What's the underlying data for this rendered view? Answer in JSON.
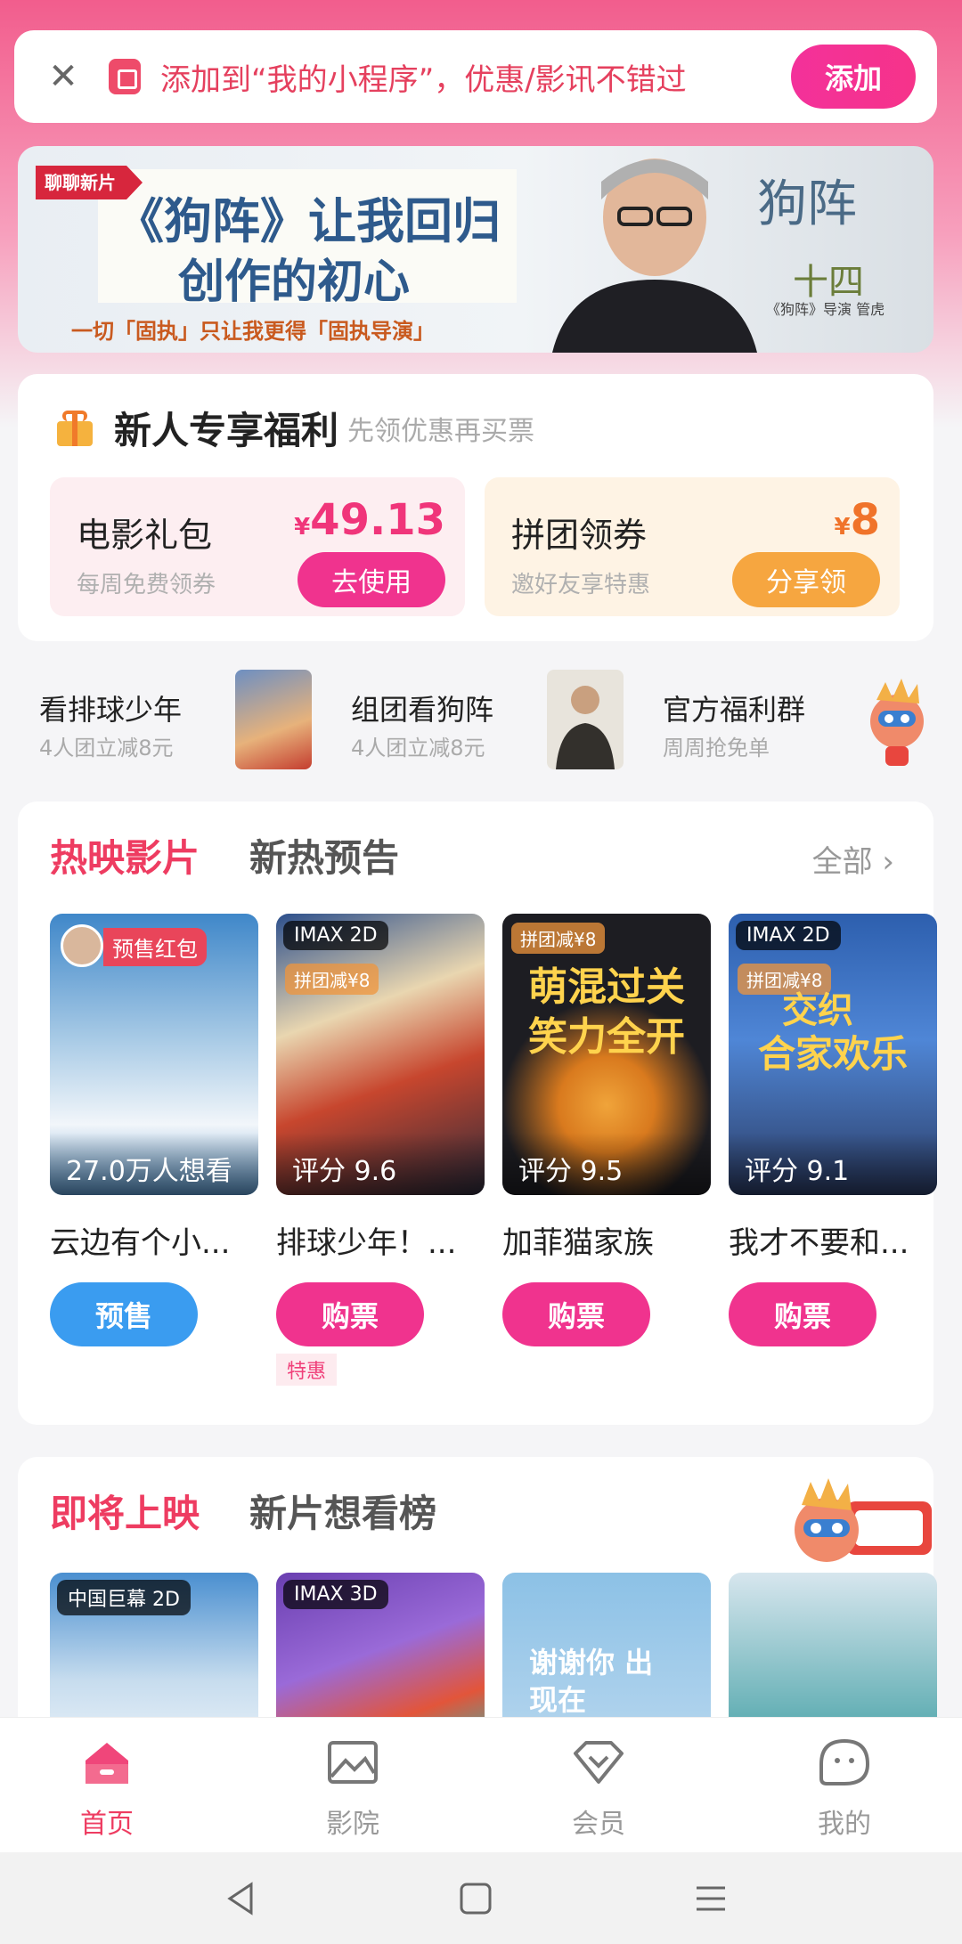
{
  "add_bar": {
    "text": "添加到“我的小程序”，优惠/影讯不错过",
    "button": "添加",
    "close_glyph": "✕"
  },
  "banner": {
    "tag": "聊聊新片",
    "line1": "《狗阵》让我回归",
    "line2": "创作的初心",
    "subline": "一切「固执」只让我更得「固执导演」",
    "calligraphy": "狗阵",
    "calligraphy_sub": "十四",
    "calligraphy_small": "《狗阵》导演 管虎"
  },
  "welfare": {
    "title": "新人专享福利",
    "subtitle": "先领优惠再买票",
    "coupons": [
      {
        "title": "电影礼包",
        "sub": "每周免费领券",
        "currency": "¥",
        "price": "49.13",
        "button": "去使用"
      },
      {
        "title": "拼团领券",
        "sub": "邀好友享特惠",
        "currency": "¥",
        "price": "8",
        "button": "分享领"
      }
    ]
  },
  "promos": [
    {
      "title": "看排球少年",
      "sub": "4人团立减8元"
    },
    {
      "title": "组团看狗阵",
      "sub": "4人团立减8元"
    },
    {
      "title": "官方福利群",
      "sub": "周周抢免单"
    }
  ],
  "now_showing": {
    "tabs": [
      "热映影片",
      "新热预告"
    ],
    "all": "全部",
    "all_arrow": "›",
    "movies": [
      {
        "name": "云边有个小...",
        "caption": "27.0万人想看",
        "badge": "",
        "promo_badge": "预售红包",
        "button": "预售",
        "type": "pre",
        "special": ""
      },
      {
        "name": "排球少年！...",
        "caption": "评分 9.6",
        "badge": "IMAX 2D",
        "promo_badge": "拼团减¥8",
        "button": "购票",
        "type": "buy",
        "special": "特惠"
      },
      {
        "name": "加菲猫家族",
        "caption": "评分 9.5",
        "badge": "",
        "promo_badge": "拼团减¥8",
        "button": "购票",
        "type": "buy",
        "special": "",
        "poster_text1": "萌混过关",
        "poster_text2": "笑力全开"
      },
      {
        "name": "我才不要和...",
        "caption": "评分 9.1",
        "badge": "IMAX 2D",
        "promo_badge": "拼团减¥8",
        "button": "购票",
        "type": "buy",
        "special": "",
        "poster_text1": "交织",
        "poster_text2": "合家欢乐"
      }
    ]
  },
  "upcoming": {
    "tabs": [
      "即将上映",
      "新片想看榜"
    ],
    "posters": [
      {
        "badge": "中国巨幕 2D"
      },
      {
        "badge": "IMAX 3D"
      },
      {
        "badge": "",
        "text": "谢谢你 出现在"
      },
      {
        "badge": ""
      }
    ]
  },
  "bottom_nav": [
    {
      "label": "首页",
      "icon": "home-icon",
      "active": true
    },
    {
      "label": "影院",
      "icon": "cinema-icon",
      "active": false
    },
    {
      "label": "会员",
      "icon": "member-diamond-icon",
      "active": false
    },
    {
      "label": "我的",
      "icon": "profile-icon",
      "active": false
    }
  ],
  "colors": {
    "accent": "#ee3c61",
    "button_pink": "#f0338e",
    "button_blue": "#3a9cf0",
    "button_orange": "#f6a640"
  }
}
